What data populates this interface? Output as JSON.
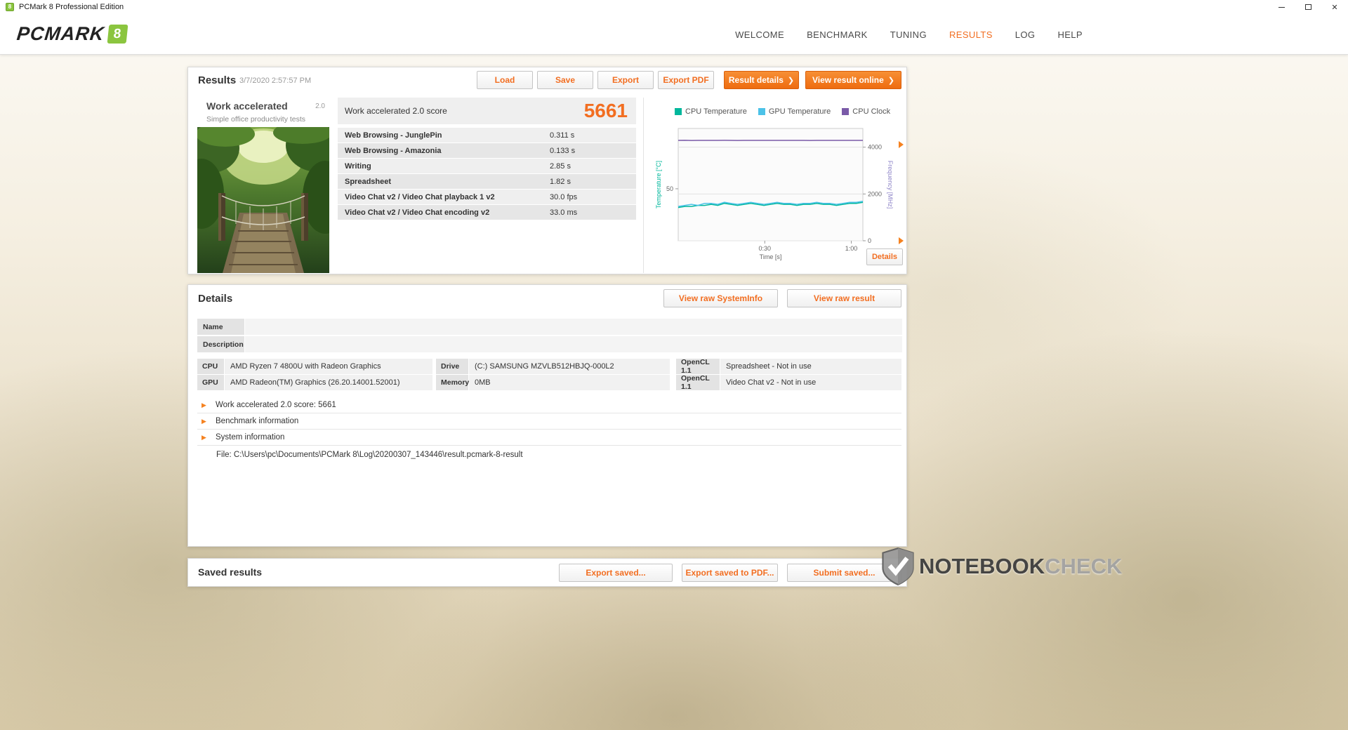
{
  "window": {
    "title": "PCMark 8 Professional Edition"
  },
  "icons": {
    "close": "✕",
    "chevron_right": "❯",
    "expander": "▶",
    "app_badge": "8"
  },
  "colors": {
    "accent": "#f26e21",
    "logo_green": "#8bc53f"
  },
  "header": {
    "logo_text": "PCMARK",
    "logo_badge": "8",
    "nav": [
      {
        "label": "WELCOME",
        "active": false
      },
      {
        "label": "BENCHMARK",
        "active": false
      },
      {
        "label": "TUNING",
        "active": false
      },
      {
        "label": "RESULTS",
        "active": true
      },
      {
        "label": "LOG",
        "active": false
      },
      {
        "label": "HELP",
        "active": false
      }
    ]
  },
  "results": {
    "title": "Results",
    "timestamp": "3/7/2020 2:57:57 PM",
    "buttons": {
      "load": "Load",
      "save": "Save",
      "export": "Export",
      "export_pdf": "Export PDF",
      "result_details": "Result details",
      "view_online": "View result online"
    },
    "test": {
      "name": "Work accelerated",
      "version": "2.0",
      "subtitle": "Simple office productivity tests"
    },
    "score_label": "Work accelerated 2.0 score",
    "score": "5661",
    "metrics": [
      {
        "label": "Web Browsing - JunglePin",
        "value": "0.311 s"
      },
      {
        "label": "Web Browsing - Amazonia",
        "value": "0.133 s"
      },
      {
        "label": "Writing",
        "value": "2.85 s"
      },
      {
        "label": "Spreadsheet",
        "value": "1.82 s"
      },
      {
        "label": "Video Chat v2 / Video Chat playback 1 v2",
        "value": "30.0 fps"
      },
      {
        "label": "Video Chat v2 / Video Chat encoding v2",
        "value": "33.0 ms"
      }
    ],
    "details_button": "Details"
  },
  "chart_data": {
    "type": "line",
    "xlabel": "Time [s]",
    "x_duration_s": 64,
    "x_ticks": [
      {
        "t": 30,
        "label": "0:30"
      },
      {
        "t": 60,
        "label": "1:00"
      }
    ],
    "left_axis": {
      "label": "Temperature [°C]",
      "color": "#00b79c",
      "range": [
        0,
        108
      ],
      "ticks": [
        {
          "v": 50,
          "label": "50"
        }
      ]
    },
    "right_axis": {
      "label": "Frequency [MHz]",
      "color": "#8f86c8",
      "range": [
        0,
        4800
      ],
      "ticks": [
        {
          "v": 4000,
          "label": "4000"
        },
        {
          "v": 2000,
          "label": "2000"
        },
        {
          "v": 0,
          "label": "0"
        }
      ]
    },
    "series": [
      {
        "name": "CPU Temperature",
        "color": "#00b79c",
        "axis": "left",
        "values": [
          32,
          33,
          33,
          34,
          34,
          35,
          34,
          36,
          35,
          34,
          35,
          36,
          35,
          34,
          35,
          36,
          35,
          35,
          34,
          35,
          35,
          36,
          35,
          35,
          34,
          35,
          36,
          36,
          37
        ]
      },
      {
        "name": "GPU Temperature",
        "color": "#4cc2e8",
        "axis": "left",
        "values": [
          33,
          34,
          35,
          34,
          36,
          36,
          35,
          37,
          36,
          35,
          36,
          37,
          36,
          35,
          36,
          37,
          36,
          36,
          35,
          36,
          36,
          37,
          36,
          36,
          35,
          36,
          37,
          37,
          38
        ]
      },
      {
        "name": "CPU Clock",
        "color": "#7a5aa8",
        "axis": "right",
        "values": [
          4290,
          4292,
          4288,
          4290,
          4291,
          4289,
          4290,
          4292,
          4290,
          4288,
          4290,
          4291,
          4290,
          4289,
          4290,
          4291,
          4290,
          4290,
          4289,
          4290,
          4288,
          4290,
          4291,
          4290,
          4290,
          4289,
          4290,
          4291,
          4290
        ]
      }
    ],
    "legend_position": "top"
  },
  "details": {
    "title": "Details",
    "buttons": {
      "view_raw_systeminfo": "View raw SystemInfo",
      "view_raw_result": "View raw result"
    },
    "fields": {
      "name_label": "Name",
      "name_value": "",
      "description_label": "Description",
      "description_value": ""
    },
    "specs": [
      {
        "label": "CPU",
        "value": "AMD Ryzen 7 4800U with Radeon Graphics"
      },
      {
        "label": "GPU",
        "value": "AMD Radeon(TM) Graphics (26.20.14001.52001)"
      },
      {
        "label": "Drive",
        "value": "(C:) SAMSUNG MZVLB512HBJQ-000L2"
      },
      {
        "label": "Memory",
        "value": "0MB"
      },
      {
        "label": "OpenCL 1.1",
        "value": "Spreadsheet - Not in use"
      },
      {
        "label": "OpenCL 1.1",
        "value": "Video Chat v2 - Not in use"
      }
    ],
    "expanders": [
      {
        "label": "Work accelerated 2.0 score: 5661"
      },
      {
        "label": "Benchmark information"
      },
      {
        "label": "System information"
      }
    ],
    "file_line": "File: C:\\Users\\pc\\Documents\\PCMark 8\\Log\\20200307_143446\\result.pcmark-8-result"
  },
  "saved": {
    "title": "Saved results",
    "buttons": {
      "export_saved": "Export saved...",
      "export_saved_pdf": "Export saved to PDF...",
      "submit_saved": "Submit saved..."
    }
  },
  "watermark": {
    "part1": "NOTEBOOK",
    "part2": "CHECK"
  }
}
